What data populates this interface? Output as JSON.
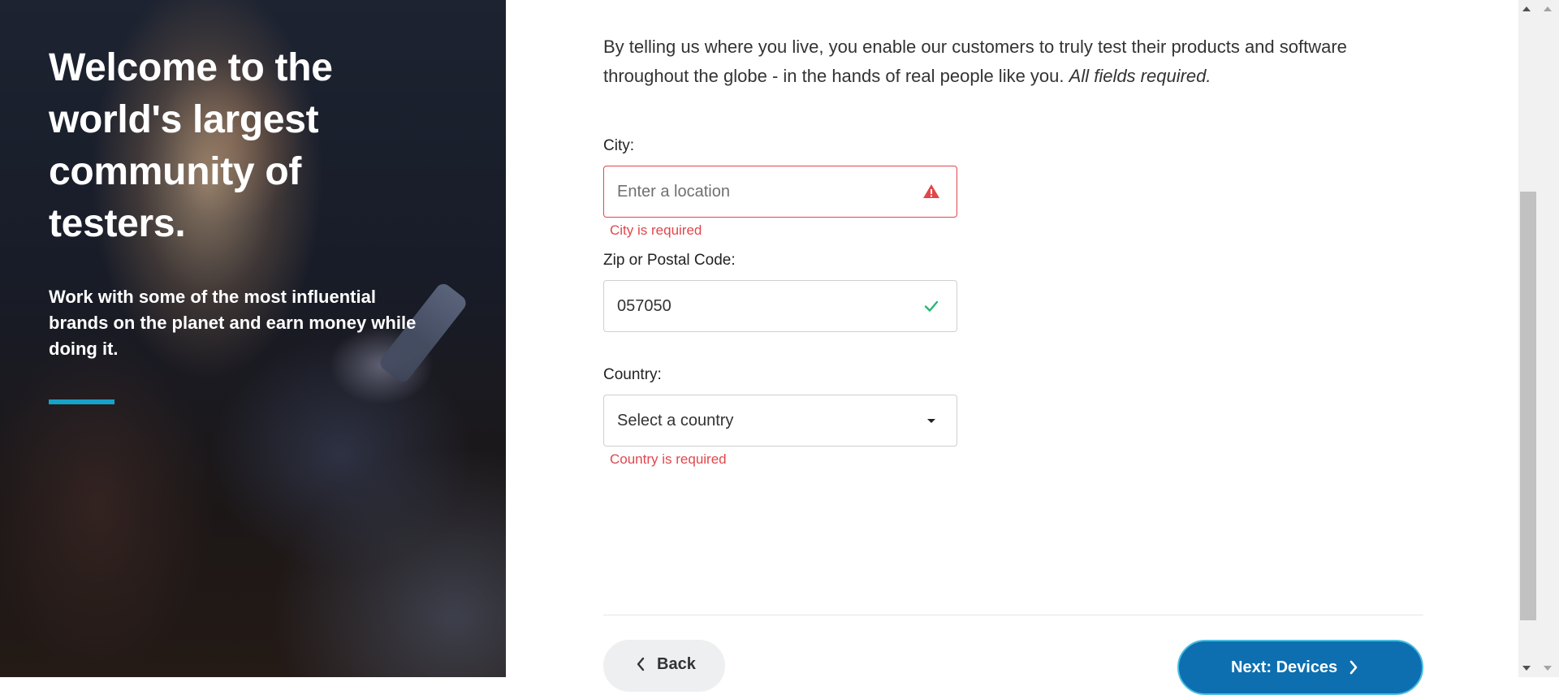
{
  "hero": {
    "title": "Welcome to the world's largest community of testers.",
    "subtitle": "Work with some of the most influential brands on the planet and earn money while doing it.",
    "accent_color": "#17a2c9"
  },
  "intro": {
    "text": "By telling us where you live, you enable our customers to truly test their products and software throughout the globe - in the hands of real people like you.",
    "required_note": "All fields required."
  },
  "form": {
    "city": {
      "label": "City:",
      "placeholder": "Enter a location",
      "value": "",
      "status_icon": "warning-icon",
      "error": "City is required"
    },
    "zip": {
      "label": "Zip or Postal Code:",
      "value": "057050",
      "status_icon": "checkmark-icon"
    },
    "country": {
      "label": "Country:",
      "selected": "Select a country",
      "error": "Country is required"
    }
  },
  "nav": {
    "back_label": "Back",
    "next_label": "Next: Devices"
  },
  "colors": {
    "error": "#e0474c",
    "success": "#2bb673",
    "primary": "#0d6fb0"
  }
}
